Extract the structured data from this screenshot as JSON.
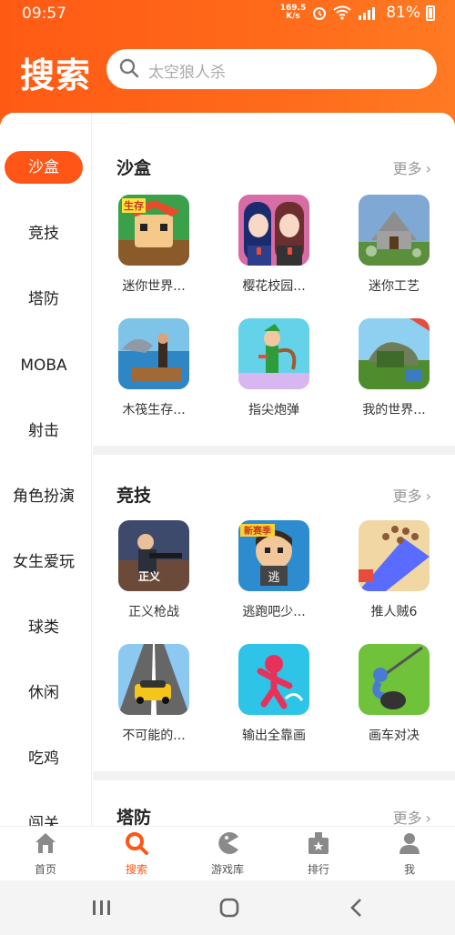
{
  "status": {
    "time": "09:57",
    "net_speed": "169.5",
    "net_unit": "K/s",
    "battery": "81%"
  },
  "header": {
    "title": "搜索",
    "search_placeholder": "太空狼人杀"
  },
  "sidebar": {
    "items": [
      "沙盒",
      "竞技",
      "塔防",
      "MOBA",
      "射击",
      "角色扮演",
      "女生爱玩",
      "球类",
      "休闲",
      "吃鸡",
      "闯关"
    ],
    "active_index": 0
  },
  "sections": [
    {
      "title": "沙盒",
      "more": "更多",
      "games": [
        {
          "name": "迷你世界...",
          "icon": "mini-world-icon"
        },
        {
          "name": "樱花校园...",
          "icon": "sakura-school-icon"
        },
        {
          "name": "迷你工艺",
          "icon": "mini-craft-icon"
        },
        {
          "name": "木筏生存...",
          "icon": "raft-survival-icon"
        },
        {
          "name": "指尖炮弹",
          "icon": "finger-cannon-icon"
        },
        {
          "name": "我的世界...",
          "icon": "my-world-icon"
        }
      ]
    },
    {
      "title": "竞技",
      "more": "更多",
      "games": [
        {
          "name": "正义枪战",
          "icon": "justice-gunfight-icon"
        },
        {
          "name": "逃跑吧少...",
          "icon": "run-away-icon"
        },
        {
          "name": "推人贼6",
          "icon": "push-crowd-icon"
        },
        {
          "name": "不可能的...",
          "icon": "impossible-car-icon"
        },
        {
          "name": "输出全靠画",
          "icon": "draw-output-icon"
        },
        {
          "name": "画车对决",
          "icon": "draw-car-duel-icon"
        }
      ]
    },
    {
      "title": "塔防",
      "more": "更多"
    }
  ],
  "icon_labels": {
    "new_season": "新赛季",
    "escape": "逃",
    "justice": "正义",
    "survival": "生存"
  },
  "bottom_nav": [
    {
      "label": "首页",
      "icon": "home-icon"
    },
    {
      "label": "搜索",
      "icon": "search-icon"
    },
    {
      "label": "游戏库",
      "icon": "pacman-icon"
    },
    {
      "label": "排行",
      "icon": "ranking-icon"
    },
    {
      "label": "我",
      "icon": "user-icon"
    }
  ],
  "colors": {
    "accent": "#ff5516",
    "header": "#ff6a1a"
  }
}
